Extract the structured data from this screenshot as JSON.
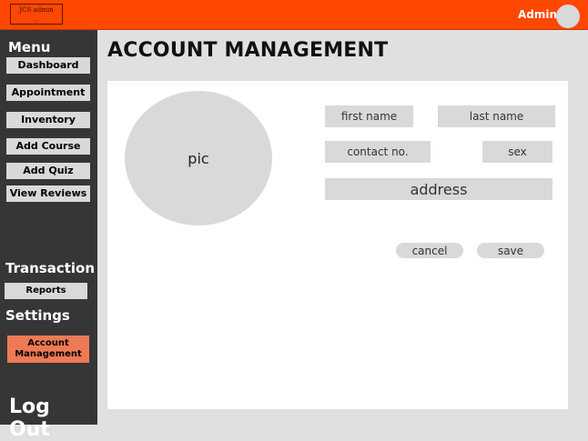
{
  "topbar": {
    "logo_text": "JCS admin",
    "logo_mark": "♡",
    "admin_label": "Admin",
    "color": "#fe4700"
  },
  "sidebar": {
    "menu_title": "Menu",
    "items": [
      {
        "label": "Dashboard"
      },
      {
        "label": "Appointment"
      },
      {
        "label": "Inventory"
      },
      {
        "label": "Add Course"
      },
      {
        "label": "Add Quiz"
      },
      {
        "label": "View Reviews"
      }
    ],
    "transaction_title": "Transaction",
    "reports_label": "Reports",
    "settings_title": "Settings",
    "account_management_label": "Account Management",
    "account_management_color": "#ee7a55",
    "logout_label": "Log Out"
  },
  "main": {
    "title": "ACCOUNT MANAGEMENT",
    "pic_label": "pic",
    "fields": {
      "first_name": "first name",
      "last_name": "last name",
      "contact": "contact no.",
      "sex": "sex",
      "address": "address"
    },
    "cancel_label": "cancel",
    "save_label": "save"
  }
}
